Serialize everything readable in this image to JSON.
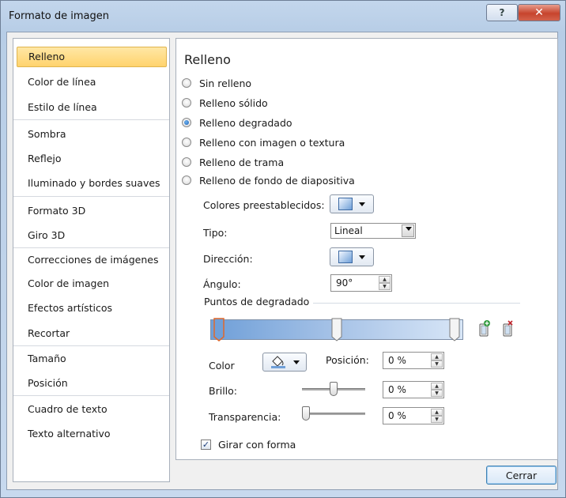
{
  "window": {
    "title": "Formato de imagen",
    "help_label": "?",
    "close_label": "✕"
  },
  "sidebar": {
    "items": [
      {
        "label": "Relleno"
      },
      {
        "label": "Color de línea"
      },
      {
        "label": "Estilo de línea"
      },
      {
        "label": "Sombra"
      },
      {
        "label": "Reflejo"
      },
      {
        "label": "Iluminado y bordes suaves"
      },
      {
        "label": "Formato 3D"
      },
      {
        "label": "Giro 3D"
      },
      {
        "label": "Correcciones de imágenes"
      },
      {
        "label": "Color de imagen"
      },
      {
        "label": "Efectos artísticos"
      },
      {
        "label": "Recortar"
      },
      {
        "label": "Tamaño"
      },
      {
        "label": "Posición"
      },
      {
        "label": "Cuadro de texto"
      },
      {
        "label": "Texto alternativo"
      }
    ],
    "selected": "Relleno"
  },
  "panel": {
    "title": "Relleno",
    "fill_options": [
      {
        "label": "Sin relleno",
        "selected": false
      },
      {
        "label": "Relleno sólido",
        "selected": false
      },
      {
        "label": "Relleno degradado",
        "selected": true
      },
      {
        "label": "Relleno con imagen o textura",
        "selected": false
      },
      {
        "label": "Relleno de trama",
        "selected": false
      },
      {
        "label": "Relleno de fondo de diapositiva",
        "selected": false
      }
    ],
    "preset_label": "Colores preestablecidos:",
    "type_label": "Tipo:",
    "type_value": "Lineal",
    "direction_label": "Dirección:",
    "angle_label": "Ángulo:",
    "angle_value": "90°",
    "gradient_stops_label": "Puntos de degradado",
    "gradient_stop_positions": [
      0,
      50,
      100
    ],
    "selected_stop": 0,
    "color_label": "Color",
    "position_label": "Posición:",
    "position_value": "0 %",
    "brightness_label": "Brillo:",
    "brightness_value": "0 %",
    "brightness_level": 0.5,
    "transparency_label": "Transparencia:",
    "transparency_value": "0 %",
    "transparency_level": 0,
    "rotate_label": "Girar con forma",
    "rotate_checked": true,
    "check_glyph": "✓"
  },
  "footer": {
    "close_label": "Cerrar"
  },
  "colors": {
    "selection": "#ffd36d",
    "accent": "#1b5fb5"
  }
}
